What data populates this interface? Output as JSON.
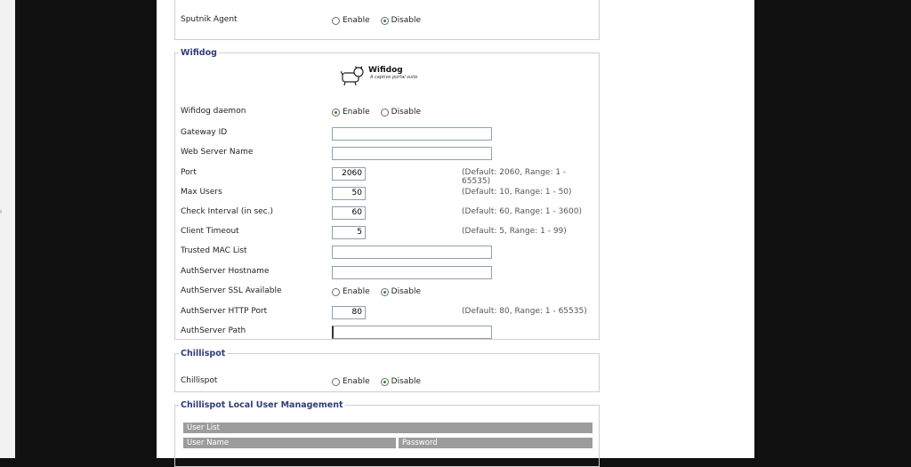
{
  "sputnik": {
    "label": "Sputnik Agent",
    "enable": "Enable",
    "disable": "Disable"
  },
  "wifidog": {
    "legend": "Wifidog",
    "logo_title": "Wifidog",
    "logo_sub": "A captive portal suite",
    "daemon": {
      "label": "Wifidog daemon",
      "enable": "Enable",
      "disable": "Disable"
    },
    "gateway_id": {
      "label": "Gateway ID",
      "value": ""
    },
    "web_server_name": {
      "label": "Web Server Name",
      "value": ""
    },
    "port": {
      "label": "Port",
      "value": "2060",
      "hint": "(Default: 2060, Range: 1 - 65535)"
    },
    "max_users": {
      "label": "Max Users",
      "value": "50",
      "hint": "(Default: 10, Range: 1 - 50)"
    },
    "check_interval": {
      "label": "Check Interval (in sec.)",
      "value": "60",
      "hint": "(Default: 60, Range: 1 - 3600)"
    },
    "client_timeout": {
      "label": "Client Timeout",
      "value": "5",
      "hint": "(Default: 5, Range: 1 - 99)"
    },
    "trusted_mac": {
      "label": "Trusted MAC List",
      "value": ""
    },
    "auth_host": {
      "label": "AuthServer Hostname",
      "value": ""
    },
    "auth_ssl": {
      "label": "AuthServer SSL Available",
      "enable": "Enable",
      "disable": "Disable"
    },
    "auth_http_port": {
      "label": "AuthServer HTTP Port",
      "value": "80",
      "hint": "(Default: 80, Range: 1 - 65535)"
    },
    "auth_path": {
      "label": "AuthServer Path",
      "value": ""
    }
  },
  "chillispot": {
    "legend": "Chillispot",
    "label": "Chillispot",
    "enable": "Enable",
    "disable": "Disable"
  },
  "chilli_users": {
    "legend": "Chillispot Local User Management",
    "list_header": "User List",
    "col_user": "User Name",
    "col_pass": "Password"
  }
}
